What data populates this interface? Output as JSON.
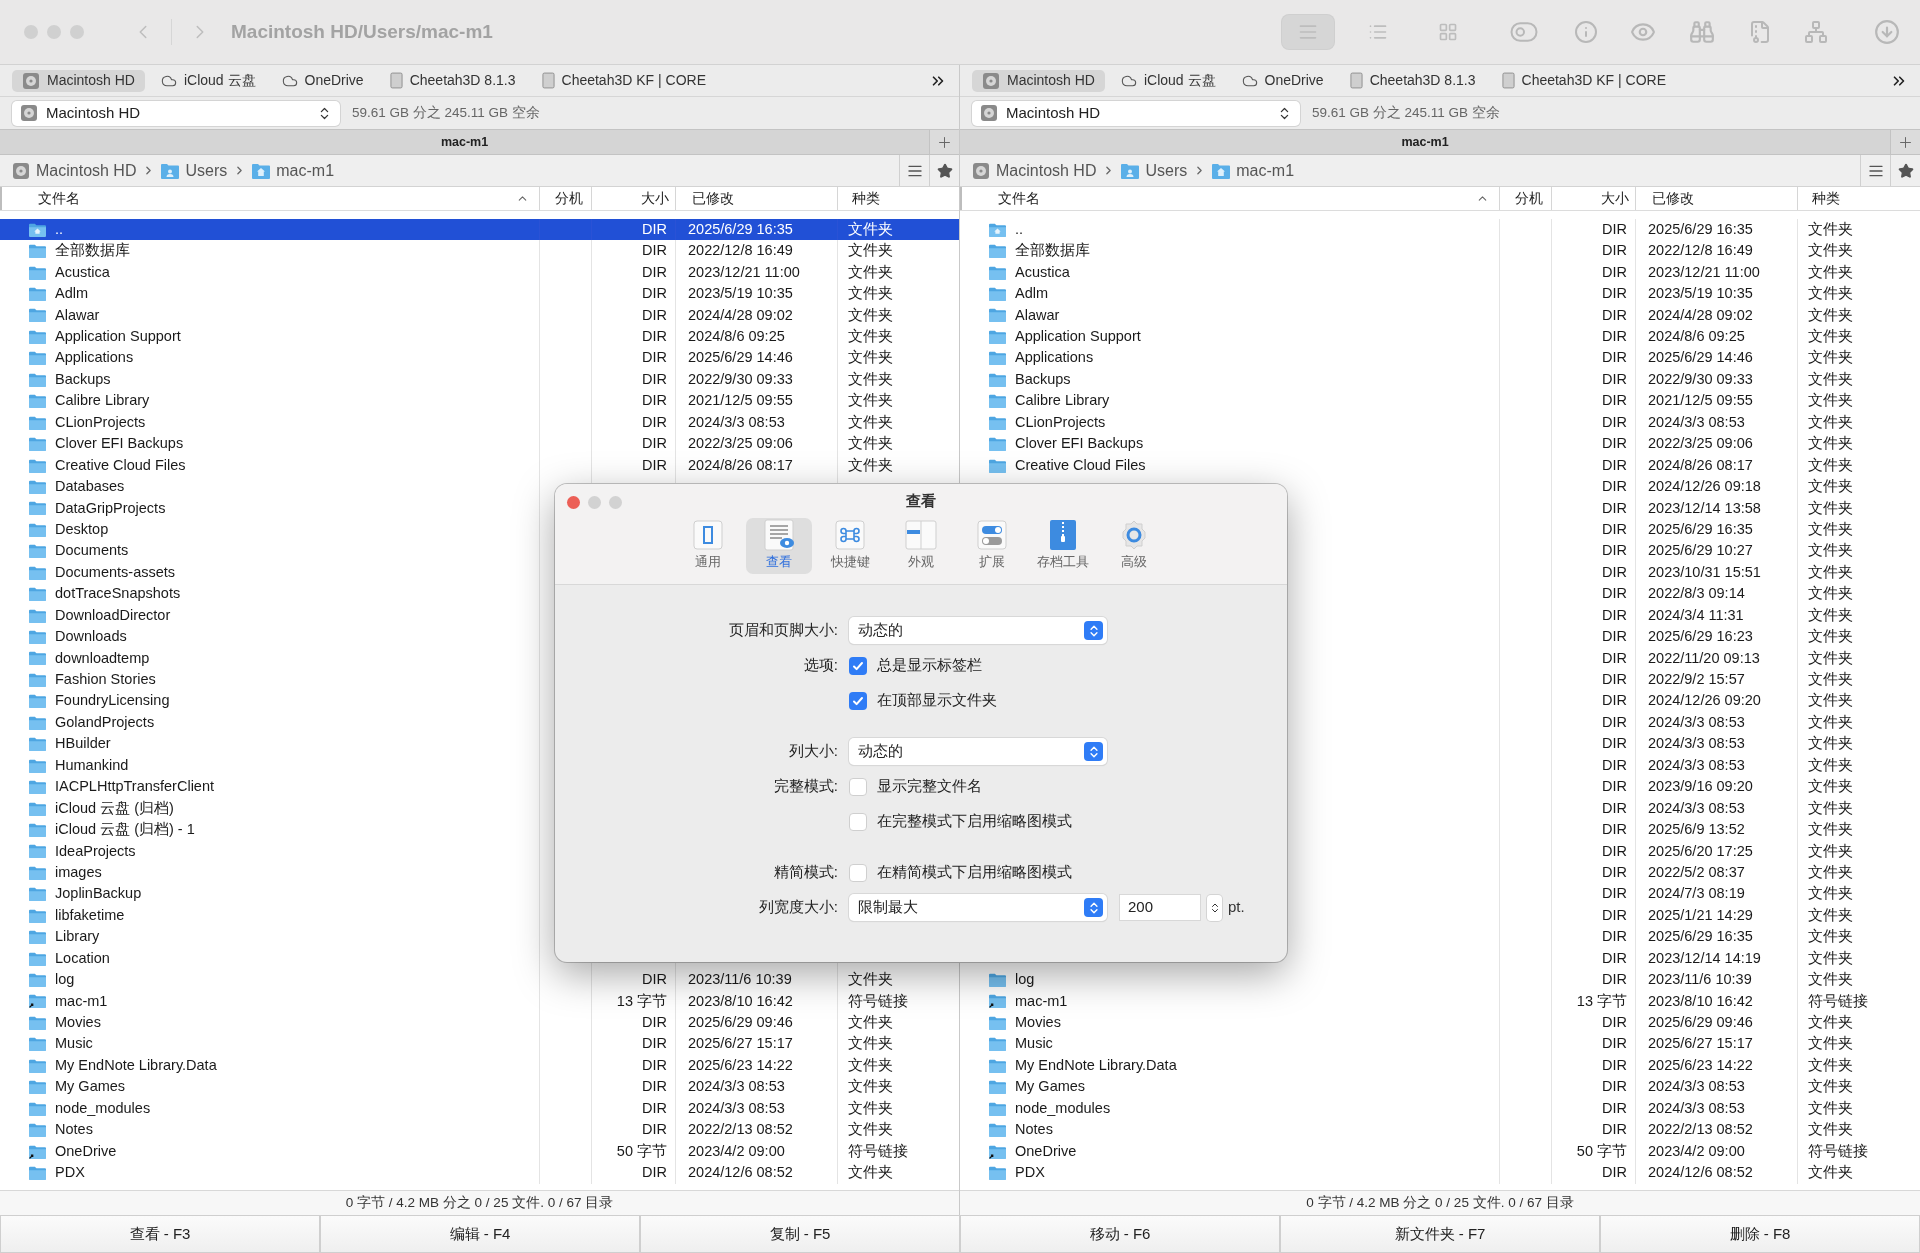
{
  "window": {
    "title": "Macintosh HD/Users/mac-m1"
  },
  "view_modes": [
    {
      "selected": true
    },
    {
      "selected": false
    },
    {
      "selected": false
    }
  ],
  "panels": [
    {
      "favorites": [
        {
          "label": "Macintosh HD",
          "kind": "drive",
          "selected": true
        },
        {
          "label": "iCloud 云盘",
          "kind": "cloud",
          "selected": false
        },
        {
          "label": "OneDrive",
          "kind": "cloud",
          "selected": false
        },
        {
          "label": "Cheetah3D 8.1.3",
          "kind": "volume",
          "selected": false
        },
        {
          "label": "Cheetah3D KF | CORE",
          "kind": "volume",
          "selected": false
        }
      ],
      "drive": {
        "name": "Macintosh HD",
        "free": "59.61 GB 分之 245.11 GB 空余"
      },
      "tab": "mac-m1",
      "breadcrumb": [
        {
          "label": "Macintosh HD",
          "kind": "drive"
        },
        {
          "label": "Users",
          "kind": "folder"
        },
        {
          "label": "mac-m1",
          "kind": "home"
        }
      ],
      "columns": [
        "文件名",
        "分机",
        "大小",
        "已修改",
        "种类"
      ],
      "rows": [
        {
          "name": "..",
          "kind": "parent",
          "size": "DIR",
          "modified": "2025/6/29 16:35",
          "type": "文件夹",
          "selected": true
        },
        {
          "name": "全部数据库",
          "kind": "folder",
          "size": "DIR",
          "modified": "2022/12/8 16:49",
          "type": "文件夹",
          "selected": false
        },
        {
          "name": "Acustica",
          "kind": "folder",
          "size": "DIR",
          "modified": "2023/12/21 11:00",
          "type": "文件夹",
          "selected": false
        },
        {
          "name": "Adlm",
          "kind": "folder",
          "size": "DIR",
          "modified": "2023/5/19 10:35",
          "type": "文件夹",
          "selected": false
        },
        {
          "name": "Alawar",
          "kind": "folder",
          "size": "DIR",
          "modified": "2024/4/28 09:02",
          "type": "文件夹",
          "selected": false
        },
        {
          "name": "Application Support",
          "kind": "folder",
          "size": "DIR",
          "modified": "2024/8/6 09:25",
          "type": "文件夹",
          "selected": false
        },
        {
          "name": "Applications",
          "kind": "folder",
          "size": "DIR",
          "modified": "2025/6/29 14:46",
          "type": "文件夹",
          "selected": false
        },
        {
          "name": "Backups",
          "kind": "folder",
          "size": "DIR",
          "modified": "2022/9/30 09:33",
          "type": "文件夹",
          "selected": false
        },
        {
          "name": "Calibre Library",
          "kind": "folder",
          "size": "DIR",
          "modified": "2021/12/5 09:55",
          "type": "文件夹",
          "selected": false
        },
        {
          "name": "CLionProjects",
          "kind": "folder",
          "size": "DIR",
          "modified": "2024/3/3 08:53",
          "type": "文件夹",
          "selected": false
        },
        {
          "name": "Clover EFI Backups",
          "kind": "folder",
          "size": "DIR",
          "modified": "2022/3/25 09:06",
          "type": "文件夹",
          "selected": false
        },
        {
          "name": "Creative Cloud Files",
          "kind": "folder",
          "size": "DIR",
          "modified": "2024/8/26 08:17",
          "type": "文件夹",
          "selected": false
        },
        {
          "name": "Databases",
          "kind": "folder",
          "selected": false
        },
        {
          "name": "DataGripProjects",
          "kind": "folder",
          "selected": false
        },
        {
          "name": "Desktop",
          "kind": "folder",
          "selected": false
        },
        {
          "name": "Documents",
          "kind": "folder",
          "selected": false
        },
        {
          "name": "Documents-assets",
          "kind": "folder",
          "selected": false
        },
        {
          "name": "dotTraceSnapshots",
          "kind": "folder",
          "selected": false
        },
        {
          "name": "DownloadDirector",
          "kind": "folder",
          "selected": false
        },
        {
          "name": "Downloads",
          "kind": "folder",
          "selected": false
        },
        {
          "name": "downloadtemp",
          "kind": "folder",
          "selected": false
        },
        {
          "name": "Fashion Stories",
          "kind": "folder",
          "selected": false
        },
        {
          "name": "FoundryLicensing",
          "kind": "folder",
          "selected": false
        },
        {
          "name": "GolandProjects",
          "kind": "folder",
          "selected": false
        },
        {
          "name": "HBuilder",
          "kind": "folder",
          "selected": false
        },
        {
          "name": "Humankind",
          "kind": "folder",
          "selected": false
        },
        {
          "name": "IACPLHttpTransferClient",
          "kind": "folder",
          "selected": false
        },
        {
          "name": "iCloud 云盘 (归档)",
          "kind": "folder",
          "selected": false
        },
        {
          "name": "iCloud 云盘 (归档) - 1",
          "kind": "folder",
          "selected": false
        },
        {
          "name": "IdeaProjects",
          "kind": "folder",
          "selected": false
        },
        {
          "name": "images",
          "kind": "folder",
          "selected": false
        },
        {
          "name": "JoplinBackup",
          "kind": "folder",
          "selected": false
        },
        {
          "name": "libfaketime",
          "kind": "folder",
          "selected": false
        },
        {
          "name": "Library",
          "kind": "folder",
          "selected": false
        },
        {
          "name": "Location",
          "kind": "folder",
          "selected": false
        },
        {
          "name": "log",
          "kind": "folder",
          "size": "DIR",
          "modified": "2023/11/6 10:39",
          "type": "文件夹",
          "selected": false
        },
        {
          "name": "mac-m1",
          "kind": "link",
          "size": "13 字节",
          "modified": "2023/8/10 16:42",
          "type": "符号链接",
          "selected": false
        },
        {
          "name": "Movies",
          "kind": "folder",
          "size": "DIR",
          "modified": "2025/6/29 09:46",
          "type": "文件夹",
          "selected": false
        },
        {
          "name": "Music",
          "kind": "folder",
          "size": "DIR",
          "modified": "2025/6/27 15:17",
          "type": "文件夹",
          "selected": false
        },
        {
          "name": "My EndNote Library.Data",
          "kind": "folder",
          "size": "DIR",
          "modified": "2025/6/23 14:22",
          "type": "文件夹",
          "selected": false
        },
        {
          "name": "My Games",
          "kind": "folder",
          "size": "DIR",
          "modified": "2024/3/3 08:53",
          "type": "文件夹",
          "selected": false
        },
        {
          "name": "node_modules",
          "kind": "folder",
          "size": "DIR",
          "modified": "2024/3/3 08:53",
          "type": "文件夹",
          "selected": false
        },
        {
          "name": "Notes",
          "kind": "folder",
          "size": "DIR",
          "modified": "2022/2/13 08:52",
          "type": "文件夹",
          "selected": false
        },
        {
          "name": "OneDrive",
          "kind": "link",
          "size": "50 字节",
          "modified": "2023/4/2 09:00",
          "type": "符号链接",
          "selected": false
        },
        {
          "name": "PDX",
          "kind": "folder",
          "size": "DIR",
          "modified": "2024/12/6 08:52",
          "type": "文件夹",
          "selected": false
        }
      ],
      "status": "0 字节 / 4.2 MB 分之 0 / 25 文件. 0 / 67 目录"
    },
    {
      "favorites": [
        {
          "label": "Macintosh HD",
          "kind": "drive",
          "selected": true
        },
        {
          "label": "iCloud 云盘",
          "kind": "cloud",
          "selected": false
        },
        {
          "label": "OneDrive",
          "kind": "cloud",
          "selected": false
        },
        {
          "label": "Cheetah3D 8.1.3",
          "kind": "volume",
          "selected": false
        },
        {
          "label": "Cheetah3D KF | CORE",
          "kind": "volume",
          "selected": false
        }
      ],
      "drive": {
        "name": "Macintosh HD",
        "free": "59.61 GB 分之 245.11 GB 空余"
      },
      "tab": "mac-m1",
      "breadcrumb": [
        {
          "label": "Macintosh HD",
          "kind": "drive"
        },
        {
          "label": "Users",
          "kind": "folder"
        },
        {
          "label": "mac-m1",
          "kind": "home"
        }
      ],
      "columns": [
        "文件名",
        "分机",
        "大小",
        "已修改",
        "种类"
      ],
      "rows": [
        {
          "name": "..",
          "kind": "parent",
          "size": "DIR",
          "modified": "2025/6/29 16:35",
          "type": "文件夹",
          "selected": false
        },
        {
          "name": "全部数据库",
          "kind": "folder",
          "size": "DIR",
          "modified": "2022/12/8 16:49",
          "type": "文件夹",
          "selected": false
        },
        {
          "name": "Acustica",
          "kind": "folder",
          "size": "DIR",
          "modified": "2023/12/21 11:00",
          "type": "文件夹",
          "selected": false
        },
        {
          "name": "Adlm",
          "kind": "folder",
          "size": "DIR",
          "modified": "2023/5/19 10:35",
          "type": "文件夹",
          "selected": false
        },
        {
          "name": "Alawar",
          "kind": "folder",
          "size": "DIR",
          "modified": "2024/4/28 09:02",
          "type": "文件夹",
          "selected": false
        },
        {
          "name": "Application Support",
          "kind": "folder",
          "size": "DIR",
          "modified": "2024/8/6 09:25",
          "type": "文件夹",
          "selected": false
        },
        {
          "name": "Applications",
          "kind": "folder",
          "size": "DIR",
          "modified": "2025/6/29 14:46",
          "type": "文件夹",
          "selected": false
        },
        {
          "name": "Backups",
          "kind": "folder",
          "size": "DIR",
          "modified": "2022/9/30 09:33",
          "type": "文件夹",
          "selected": false
        },
        {
          "name": "Calibre Library",
          "kind": "folder",
          "size": "DIR",
          "modified": "2021/12/5 09:55",
          "type": "文件夹",
          "selected": false
        },
        {
          "name": "CLionProjects",
          "kind": "folder",
          "size": "DIR",
          "modified": "2024/3/3 08:53",
          "type": "文件夹",
          "selected": false
        },
        {
          "name": "Clover EFI Backups",
          "kind": "folder",
          "size": "DIR",
          "modified": "2022/3/25 09:06",
          "type": "文件夹",
          "selected": false
        },
        {
          "name": "Creative Cloud Files",
          "kind": "folder",
          "size": "DIR",
          "modified": "2024/8/26 08:17",
          "type": "文件夹",
          "selected": false
        },
        {
          "size": "DIR",
          "modified": "2024/12/26 09:18",
          "type": "文件夹",
          "selected": false
        },
        {
          "size": "DIR",
          "modified": "2023/12/14 13:58",
          "type": "文件夹",
          "selected": false
        },
        {
          "size": "DIR",
          "modified": "2025/6/29 16:35",
          "type": "文件夹",
          "selected": false
        },
        {
          "size": "DIR",
          "modified": "2025/6/29 10:27",
          "type": "文件夹",
          "selected": false
        },
        {
          "size": "DIR",
          "modified": "2023/10/31 15:51",
          "type": "文件夹",
          "selected": false
        },
        {
          "size": "DIR",
          "modified": "2022/8/3 09:14",
          "type": "文件夹",
          "selected": false
        },
        {
          "size": "DIR",
          "modified": "2024/3/4 11:31",
          "type": "文件夹",
          "selected": false
        },
        {
          "size": "DIR",
          "modified": "2025/6/29 16:23",
          "type": "文件夹",
          "selected": false
        },
        {
          "size": "DIR",
          "modified": "2022/11/20 09:13",
          "type": "文件夹",
          "selected": false
        },
        {
          "size": "DIR",
          "modified": "2022/9/2 15:57",
          "type": "文件夹",
          "selected": false
        },
        {
          "size": "DIR",
          "modified": "2024/12/26 09:20",
          "type": "文件夹",
          "selected": false
        },
        {
          "size": "DIR",
          "modified": "2024/3/3 08:53",
          "type": "文件夹",
          "selected": false
        },
        {
          "size": "DIR",
          "modified": "2024/3/3 08:53",
          "type": "文件夹",
          "selected": false
        },
        {
          "size": "DIR",
          "modified": "2024/3/3 08:53",
          "type": "文件夹",
          "selected": false
        },
        {
          "size": "DIR",
          "modified": "2023/9/16 09:20",
          "type": "文件夹",
          "selected": false
        },
        {
          "size": "DIR",
          "modified": "2024/3/3 08:53",
          "type": "文件夹",
          "selected": false
        },
        {
          "size": "DIR",
          "modified": "2025/6/9 13:52",
          "type": "文件夹",
          "selected": false
        },
        {
          "size": "DIR",
          "modified": "2025/6/20 17:25",
          "type": "文件夹",
          "selected": false
        },
        {
          "size": "DIR",
          "modified": "2022/5/2 08:37",
          "type": "文件夹",
          "selected": false
        },
        {
          "size": "DIR",
          "modified": "2024/7/3 08:19",
          "type": "文件夹",
          "selected": false
        },
        {
          "size": "DIR",
          "modified": "2025/1/21 14:29",
          "type": "文件夹",
          "selected": false
        },
        {
          "size": "DIR",
          "modified": "2025/6/29 16:35",
          "type": "文件夹",
          "selected": false
        },
        {
          "size": "DIR",
          "modified": "2023/12/14 14:19",
          "type": "文件夹",
          "selected": false
        },
        {
          "name": "log",
          "kind": "folder",
          "size": "DIR",
          "modified": "2023/11/6 10:39",
          "type": "文件夹",
          "selected": false
        },
        {
          "name": "mac-m1",
          "kind": "link",
          "size": "13 字节",
          "modified": "2023/8/10 16:42",
          "type": "符号链接",
          "selected": false
        },
        {
          "name": "Movies",
          "kind": "folder",
          "size": "DIR",
          "modified": "2025/6/29 09:46",
          "type": "文件夹",
          "selected": false
        },
        {
          "name": "Music",
          "kind": "folder",
          "size": "DIR",
          "modified": "2025/6/27 15:17",
          "type": "文件夹",
          "selected": false
        },
        {
          "name": "My EndNote Library.Data",
          "kind": "folder",
          "size": "DIR",
          "modified": "2025/6/23 14:22",
          "type": "文件夹",
          "selected": false
        },
        {
          "name": "My Games",
          "kind": "folder",
          "size": "DIR",
          "modified": "2024/3/3 08:53",
          "type": "文件夹",
          "selected": false
        },
        {
          "name": "node_modules",
          "kind": "folder",
          "size": "DIR",
          "modified": "2024/3/3 08:53",
          "type": "文件夹",
          "selected": false
        },
        {
          "name": "Notes",
          "kind": "folder",
          "size": "DIR",
          "modified": "2022/2/13 08:52",
          "type": "文件夹",
          "selected": false
        },
        {
          "name": "OneDrive",
          "kind": "link",
          "size": "50 字节",
          "modified": "2023/4/2 09:00",
          "type": "符号链接",
          "selected": false
        },
        {
          "name": "PDX",
          "kind": "folder",
          "size": "DIR",
          "modified": "2024/12/6 08:52",
          "type": "文件夹",
          "selected": false
        }
      ],
      "status": "0 字节 / 4.2 MB 分之 0 / 25 文件. 0 / 67 目录"
    }
  ],
  "function_keys": [
    "查看 - F3",
    "编辑 - F4",
    "复制 - F5",
    "移动 - F6",
    "新文件夹 - F7",
    "删除 - F8"
  ],
  "dialog": {
    "title": "查看",
    "tabs": [
      {
        "label": "通用",
        "selected": false
      },
      {
        "label": "查看",
        "selected": true
      },
      {
        "label": "快捷键",
        "selected": false
      },
      {
        "label": "外观",
        "selected": false
      },
      {
        "label": "扩展",
        "selected": false
      },
      {
        "label": "存档工具",
        "selected": false
      },
      {
        "label": "高级",
        "selected": false
      }
    ],
    "groups": [
      [
        {
          "kind": "select",
          "label": "页眉和页脚大小:",
          "value": "动态的"
        },
        {
          "kind": "checkbox",
          "label": "选项:",
          "text": "总是显示标签栏",
          "checked": true
        },
        {
          "kind": "checkbox",
          "text": "在顶部显示文件夹",
          "checked": true
        }
      ],
      [
        {
          "kind": "select",
          "label": "列大小:",
          "value": "动态的"
        },
        {
          "kind": "checkbox",
          "label": "完整模式:",
          "text": "显示完整文件名",
          "checked": false
        },
        {
          "kind": "checkbox",
          "text": "在完整模式下启用缩略图模式",
          "checked": false
        }
      ],
      [
        {
          "kind": "checkbox",
          "label": "精简模式:",
          "text": "在精简模式下启用缩略图模式",
          "checked": false
        },
        {
          "kind": "select_number",
          "label": "列宽度大小:",
          "value": "限制最大",
          "number": "200",
          "unit": "pt."
        }
      ]
    ]
  }
}
